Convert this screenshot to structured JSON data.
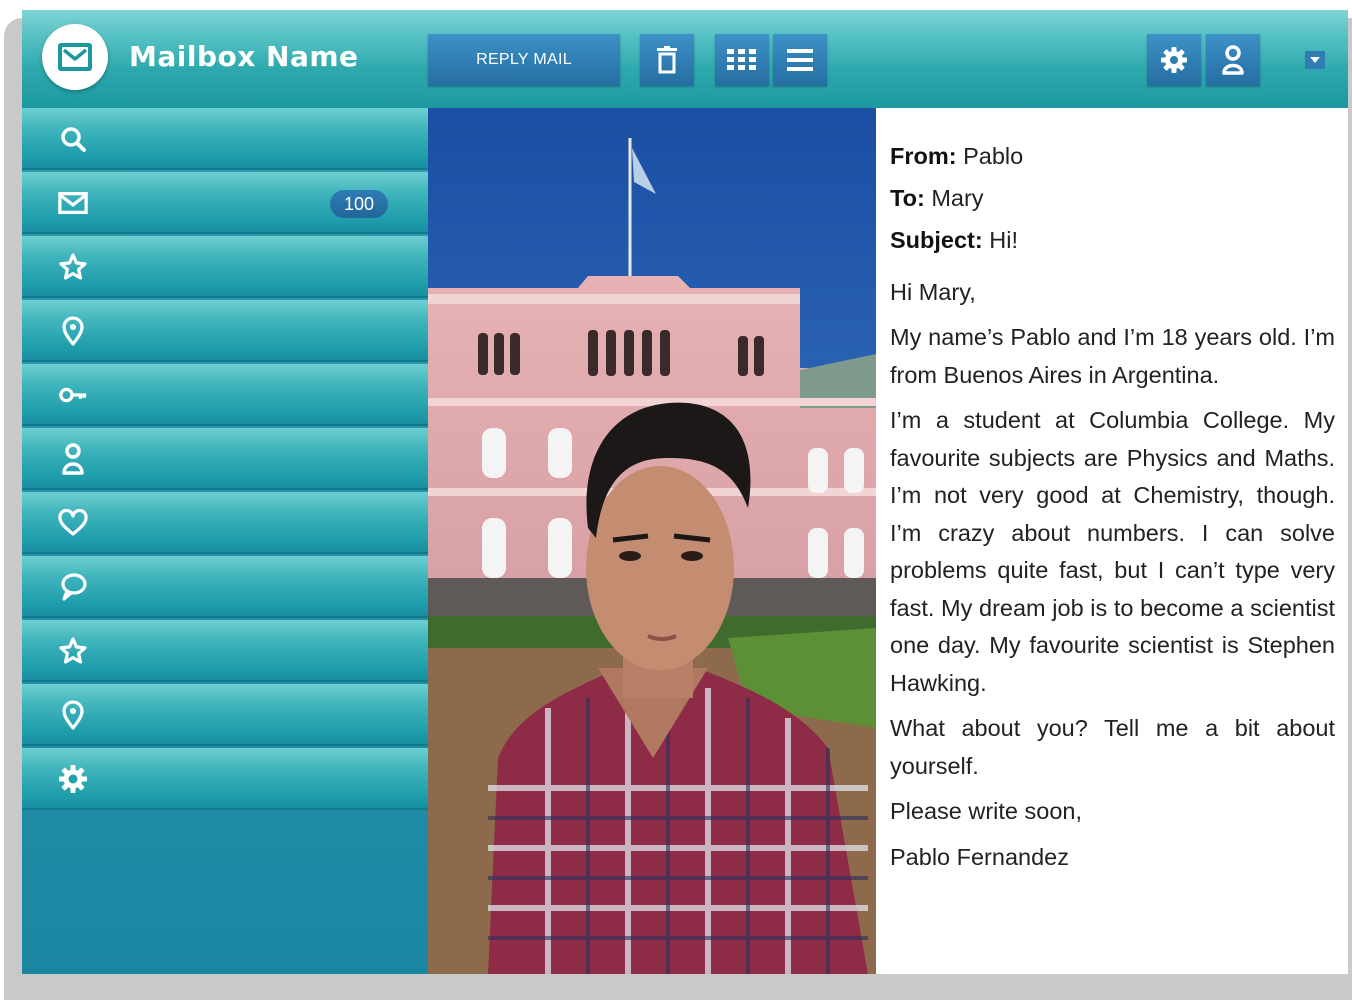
{
  "header": {
    "mailbox_name": "Mailbox Name",
    "logo_icon": "envelope-icon",
    "reply_label": "REPLY MAIL",
    "toolbar_icons": [
      "trash-icon",
      "grid-icon",
      "list-icon"
    ],
    "right_icons": [
      "gear-icon",
      "user-icon",
      "dropdown-arrow-icon"
    ]
  },
  "sidebar": {
    "items": [
      {
        "icon": "search-icon"
      },
      {
        "icon": "envelope-icon",
        "badge": "100"
      },
      {
        "icon": "star-icon"
      },
      {
        "icon": "location-pin-icon"
      },
      {
        "icon": "key-icon"
      },
      {
        "icon": "user-icon"
      },
      {
        "icon": "heart-icon"
      },
      {
        "icon": "speech-bubble-icon"
      },
      {
        "icon": "star-icon"
      },
      {
        "icon": "location-pin-icon"
      },
      {
        "icon": "gear-icon"
      }
    ]
  },
  "message": {
    "from_label": "From:",
    "from_value": "Pablo",
    "to_label": "To:",
    "to_value": "Mary",
    "subject_label": "Subject:",
    "subject_value": "Hi!",
    "greeting": "Hi Mary,",
    "paragraph_1": "My name’s Pablo and I’m 18 years old. I’m from Buenos Aires in Argentina.",
    "paragraph_2": "I’m a student at Columbia College. My favourite subjects are Physics and Maths. I’m not very good at Chemistry, though. I’m crazy about numbers. I can solve problems quite fast, but I can’t type very fast. My dream job is to become a scientist one day. My favourite scientist is Stephen Hawking.",
    "paragraph_3": "What about you? Tell me a bit about yourself.",
    "closing": "Please write soon,",
    "signature": "Pablo Fernandez"
  },
  "colors": {
    "topbar_teal": "#2ea9ae",
    "sidebar_teal": "#22a0ad",
    "button_blue": "#2f7db3",
    "sky_blue": "#1d56a8",
    "building_pink": "#e6a9ad"
  }
}
